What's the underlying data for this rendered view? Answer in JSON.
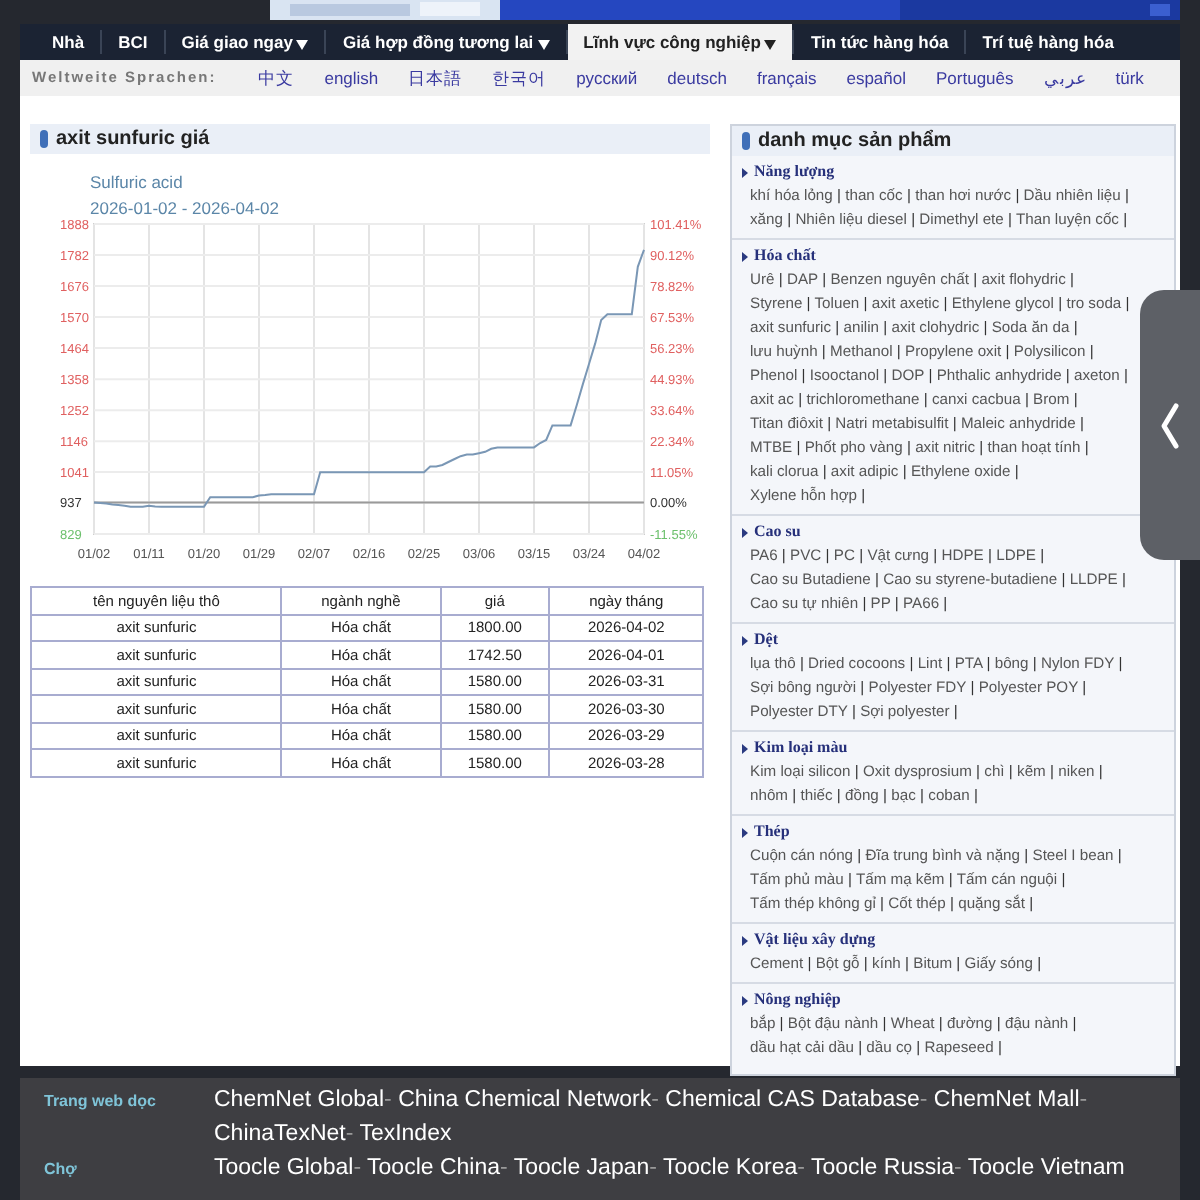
{
  "nav": [
    {
      "label": "Nhà",
      "selected": false,
      "menu": false
    },
    {
      "label": "BCI",
      "selected": false,
      "menu": false
    },
    {
      "label": "Giá giao ngay",
      "selected": false,
      "menu": true
    },
    {
      "label": "Giá hợp đồng tương lai",
      "selected": false,
      "menu": true
    },
    {
      "label": "Lĩnh vực công nghiệp",
      "selected": true,
      "menu": true
    },
    {
      "label": "Tin tức hàng hóa",
      "selected": false,
      "menu": false
    },
    {
      "label": "Trí tuệ hàng hóa",
      "selected": false,
      "menu": false
    }
  ],
  "languages": {
    "label": "Weltweite Sprachen:",
    "items": [
      "中文",
      "english",
      "日本語",
      "한국어",
      "русский",
      "deutsch",
      "français",
      "español",
      "Português",
      "عربي",
      "türk"
    ]
  },
  "price_panel": {
    "title": "axit sunfuric giá",
    "chart_data": {
      "type": "line",
      "subtitle": "2026-01-02 - 2026-04-02",
      "categories": [
        "01/02",
        null,
        null,
        null,
        null,
        null,
        null,
        null,
        null,
        "01/11",
        null,
        null,
        null,
        null,
        null,
        null,
        null,
        null,
        "01/20",
        null,
        null,
        null,
        null,
        null,
        null,
        null,
        null,
        "01/29",
        null,
        null,
        null,
        null,
        null,
        null,
        null,
        null,
        "02/07",
        null,
        null,
        null,
        null,
        null,
        null,
        null,
        null,
        "02/16",
        null,
        null,
        null,
        null,
        null,
        null,
        null,
        null,
        "02/25",
        null,
        null,
        null,
        null,
        null,
        null,
        null,
        null,
        "03/06",
        null,
        null,
        null,
        null,
        null,
        null,
        null,
        null,
        "03/15",
        null,
        null,
        null,
        null,
        null,
        null,
        null,
        null,
        "03/24",
        null,
        null,
        null,
        null,
        null,
        null,
        null,
        null,
        "04/02"
      ],
      "series": [
        {
          "name": "Sulfuric acid",
          "color": "#7a97b5",
          "values": [
            937,
            935,
            933,
            930,
            928,
            925,
            922,
            922,
            922,
            925,
            923,
            922,
            922,
            922,
            922,
            922,
            922,
            922,
            922,
            955,
            955,
            955,
            955,
            955,
            955,
            955,
            955,
            960,
            962,
            965,
            965,
            965,
            965,
            965,
            965,
            965,
            965,
            1040,
            1040,
            1040,
            1040,
            1040,
            1040,
            1040,
            1040,
            1040,
            1040,
            1040,
            1040,
            1040,
            1040,
            1040,
            1040,
            1040,
            1040,
            1060,
            1060,
            1065,
            1075,
            1085,
            1095,
            1100,
            1100,
            1105,
            1110,
            1120,
            1125,
            1125,
            1125,
            1125,
            1125,
            1125,
            1125,
            1140,
            1150,
            1200,
            1200,
            1200,
            1200,
            1270,
            1340,
            1410,
            1480,
            1560,
            1580,
            1580,
            1580,
            1580,
            1580,
            1742,
            1800
          ]
        }
      ],
      "ylim": [
        829,
        1888
      ],
      "yticks": [
        829,
        937,
        1041,
        1146,
        1252,
        1358,
        1464,
        1570,
        1676,
        1782,
        1888
      ],
      "grid": true,
      "ref_lines": [
        {
          "axis": "y",
          "value": 937
        }
      ]
    },
    "percent_axis": [
      {
        "label": "101.41%",
        "color": "#e06060"
      },
      {
        "label": "90.12%",
        "color": "#e06060"
      },
      {
        "label": "78.82%",
        "color": "#e06060"
      },
      {
        "label": "67.53%",
        "color": "#e06060"
      },
      {
        "label": "56.23%",
        "color": "#e06060"
      },
      {
        "label": "44.93%",
        "color": "#e06060"
      },
      {
        "label": "33.64%",
        "color": "#e06060"
      },
      {
        "label": "22.34%",
        "color": "#e06060"
      },
      {
        "label": "11.05%",
        "color": "#e06060"
      },
      {
        "label": "0.00%",
        "color": "#333333"
      },
      {
        "label": "-11.55%",
        "color": "#6cc06c"
      }
    ],
    "table": {
      "columns": [
        "tên nguyên liệu thô",
        "ngành nghề",
        "giá",
        "ngày tháng"
      ],
      "rows": [
        [
          "axit sunfuric",
          "Hóa chất",
          "1800.00",
          "2026-04-02"
        ],
        [
          "axit sunfuric",
          "Hóa chất",
          "1742.50",
          "2026-04-01"
        ],
        [
          "axit sunfuric",
          "Hóa chất",
          "1580.00",
          "2026-03-31"
        ],
        [
          "axit sunfuric",
          "Hóa chất",
          "1580.00",
          "2026-03-30"
        ],
        [
          "axit sunfuric",
          "Hóa chất",
          "1580.00",
          "2026-03-29"
        ],
        [
          "axit sunfuric",
          "Hóa chất",
          "1580.00",
          "2026-03-28"
        ]
      ]
    }
  },
  "categories": {
    "title": "danh mục sản phẩm",
    "separator": "|",
    "sections": [
      {
        "title": "Năng lượng",
        "items": [
          "khí hóa lỏng",
          "than cốc",
          "than hơi nước",
          "Dầu nhiên liệu",
          "xăng",
          "Nhiên liệu diesel",
          "Dimethyl ete",
          "Than luyện cốc"
        ]
      },
      {
        "title": "Hóa chất",
        "items": [
          "Urê",
          "DAP",
          "Benzen nguyên chất",
          "axit flohydric",
          "Styrene",
          "Toluen",
          "axit axetic",
          "Ethylene glycol",
          "tro soda",
          "axit sunfuric",
          "anilin",
          "axit clohydric",
          "Soda ăn da",
          "lưu huỳnh",
          "Methanol",
          "Propylene oxit",
          "Polysilicon",
          "Phenol",
          "Isooctanol",
          "DOP",
          "Phthalic anhydride",
          "axeton",
          "axit ac",
          "trichloromethane",
          "canxi cacbua",
          "Brom",
          "Titan điôxit",
          "Natri metabisulfit",
          "Maleic anhydride",
          "MTBE",
          "Phốt pho vàng",
          "axit nitric",
          "than hoạt tính",
          "kali clorua",
          "axit adipic",
          "Ethylene oxide",
          "Xylene hỗn hợp"
        ]
      },
      {
        "title": "Cao su",
        "items": [
          "PA6",
          "PVC",
          "PC",
          "Vật cưng",
          "HDPE",
          "LDPE",
          "Cao su Butadiene",
          "Cao su styrene-butadiene",
          "LLDPE",
          "Cao su tự nhiên",
          "PP",
          "PA66"
        ]
      },
      {
        "title": "Dệt",
        "items": [
          "lụa thô",
          "Dried cocoons",
          "Lint",
          "PTA",
          "bông",
          "Nylon FDY",
          "Sợi bông người",
          "Polyester FDY",
          "Polyester POY",
          "Polyester DTY",
          "Sợi polyester"
        ]
      },
      {
        "title": "Kim loại màu",
        "items": [
          "Kim loại silicon",
          "Oxit dysprosium",
          "chì",
          "kẽm",
          "niken",
          "nhôm",
          "thiếc",
          "đồng",
          "bạc",
          "coban"
        ]
      },
      {
        "title": "Thép",
        "items": [
          "Cuộn cán nóng",
          "Đĩa trung bình và nặng",
          "Steel I bean",
          "Tấm phủ màu",
          "Tấm mạ kẽm",
          "Tấm cán nguội",
          "Tấm thép không gỉ",
          "Cốt thép",
          "quặng sắt"
        ]
      },
      {
        "title": "Vật liệu xây dựng",
        "items": [
          "Cement",
          "Bột gỗ",
          "kính",
          "Bitum",
          "Giấy sóng"
        ]
      },
      {
        "title": "Nông nghiệp",
        "items": [
          "bắp",
          "Bột đậu nành",
          "Wheat",
          "đường",
          "đậu nành",
          "dầu hạt cải dầu",
          "dầu cọ",
          "Rapeseed"
        ]
      }
    ]
  },
  "footer": {
    "separator": "-",
    "rows": [
      {
        "label": "Trang web dọc",
        "links": [
          "ChemNet Global",
          "China Chemical Network",
          "Chemical CAS Database",
          "ChemNet Mall",
          "ChinaTexNet",
          "TexIndex"
        ]
      },
      {
        "label": "Chợ",
        "links": [
          "Toocle Global",
          "Toocle China",
          "Toocle Japan",
          "Toocle Korea",
          "Toocle Russia",
          "Toocle Vietnam"
        ]
      }
    ]
  }
}
